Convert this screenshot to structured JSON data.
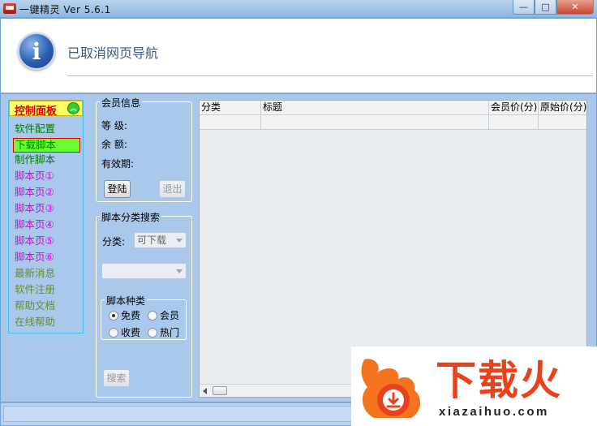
{
  "window": {
    "title": "一键精灵  Ver 5.6.1",
    "minimize_glyph": "—",
    "maximize_glyph": "□",
    "close_glyph": "✕"
  },
  "header": {
    "message": "已取消网页导航",
    "icon": "info-icon",
    "icon_glyph": "i"
  },
  "control_panel": {
    "title": "控制面板",
    "collapse_glyph": "︽",
    "items": [
      {
        "label": "软件配置",
        "color": "#008000"
      },
      {
        "label": "下载脚本",
        "color": "#008000",
        "selected": true
      },
      {
        "label": "制作脚本",
        "color": "#008000"
      },
      {
        "label": "脚本页①",
        "color": "#e000e0"
      },
      {
        "label": "脚本页②",
        "color": "#e000e0"
      },
      {
        "label": "脚本页③",
        "color": "#e000e0"
      },
      {
        "label": "脚本页④",
        "color": "#e000e0"
      },
      {
        "label": "脚本页⑤",
        "color": "#e000e0"
      },
      {
        "label": "脚本页⑥",
        "color": "#e000e0"
      },
      {
        "label": "最新消息",
        "color": "#6b8e23"
      },
      {
        "label": "软件注册",
        "color": "#6b8e23"
      },
      {
        "label": "帮助文档",
        "color": "#6b8e23"
      },
      {
        "label": "在线帮助",
        "color": "#6b8e23"
      }
    ]
  },
  "member_info": {
    "title": "会员信息",
    "level_label": "等    级:",
    "balance_label": "余    额:",
    "expiry_label": "有效期:",
    "login_label": "登陆",
    "logout_label": "退出"
  },
  "category_search": {
    "title": "脚本分类搜索",
    "category_label": "分类:",
    "category_value": "可下载",
    "second_select_value": "",
    "script_type": {
      "title": "脚本种类",
      "options": [
        {
          "label": "免费",
          "checked": true
        },
        {
          "label": "会员",
          "checked": false
        },
        {
          "label": "收费",
          "checked": false
        },
        {
          "label": "热门",
          "checked": false
        }
      ]
    },
    "search_label": "搜索"
  },
  "table": {
    "columns": [
      "分类",
      "标题",
      "会员价(分)",
      "原始价(分)"
    ],
    "rows": [
      [
        "",
        "",
        "",
        ""
      ]
    ]
  },
  "watermark": {
    "brand": "下载火",
    "url": "xiazaihuo.com"
  },
  "colors": {
    "accent_red": "#e00000",
    "panel_bg": "#a9c8ec",
    "brand_orange": "#e8421c"
  }
}
